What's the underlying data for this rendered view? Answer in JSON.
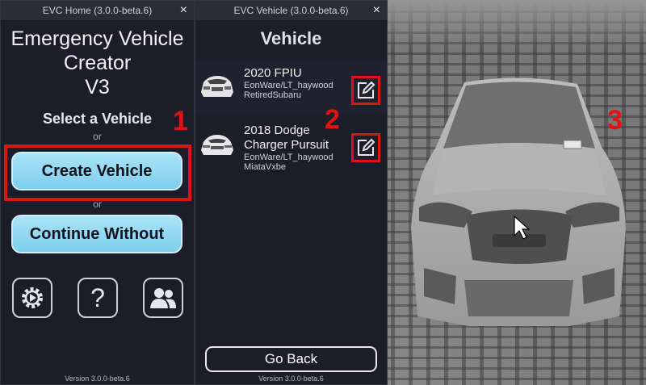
{
  "home_window": {
    "title": "EVC Home (3.0.0-beta.6)",
    "close": "×",
    "app_title_line1": "Emergency Vehicle",
    "app_title_line2": "Creator",
    "app_title_line3": "V3",
    "select_label": "Select a Vehicle",
    "or1": "or",
    "create_button": "Create Vehicle",
    "or2": "or",
    "continue_button": "Continue Without",
    "icons": [
      "gear-icon",
      "help-icon",
      "users-icon"
    ],
    "help_glyph": "?",
    "version": "Version 3.0.0-beta.6"
  },
  "vehicle_window": {
    "title": "EVC Vehicle (3.0.0-beta.6)",
    "close": "×",
    "heading": "Vehicle",
    "vehicles": [
      {
        "name": "2020 FPIU",
        "author": "EonWare/LT_haywood",
        "owner": "RetiredSubaru"
      },
      {
        "name_line1": "2018 Dodge",
        "name_line2": "Charger Pursuit",
        "author": "EonWare/LT_haywood",
        "owner": "MiataVxbe"
      }
    ],
    "go_back": "Go Back",
    "version": "Version 3.0.0-beta.6"
  },
  "markers": {
    "one": "1",
    "two": "2",
    "three": "3"
  },
  "colors": {
    "accent": "#7ecfee",
    "highlight": "#e01212",
    "panel": "#1c1d29"
  }
}
